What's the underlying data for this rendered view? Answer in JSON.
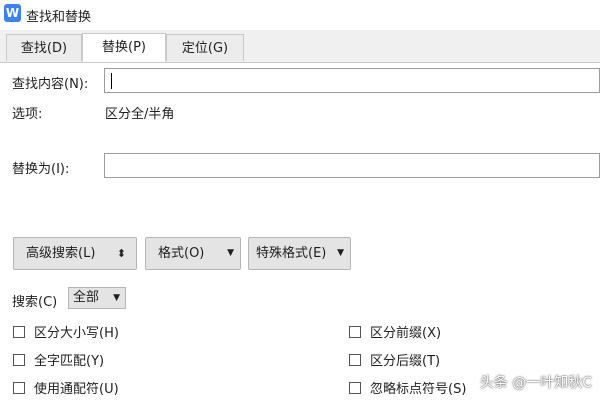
{
  "window": {
    "app_icon": "W",
    "title": "查找和替换"
  },
  "tabs": [
    {
      "label": "查找(D)"
    },
    {
      "label": "替换(P)",
      "active": true
    },
    {
      "label": "定位(G)"
    }
  ],
  "find": {
    "label": "查找内容(N):",
    "value": ""
  },
  "options": {
    "label": "选项:",
    "value": "区分全/半角"
  },
  "replace": {
    "label": "替换为(I):",
    "value": ""
  },
  "buttons": {
    "advanced": "高级搜索(L)",
    "advanced_arrow": "⬍",
    "format": "格式(O)",
    "special": "特殊格式(E)",
    "dropdown_arrow": "▼"
  },
  "search": {
    "label": "搜索(C)",
    "selected": "全部"
  },
  "checkboxes_left": [
    {
      "label": "区分大小写(H)",
      "checked": false
    },
    {
      "label": "全字匹配(Y)",
      "checked": false
    },
    {
      "label": "使用通配符(U)",
      "checked": false
    }
  ],
  "checkboxes_right": [
    {
      "label": "区分前缀(X)",
      "checked": false
    },
    {
      "label": "区分后缀(T)",
      "checked": false
    },
    {
      "label": "忽略标点符号(S)",
      "checked": false
    }
  ],
  "watermark": "头条 @一叶知秋C"
}
